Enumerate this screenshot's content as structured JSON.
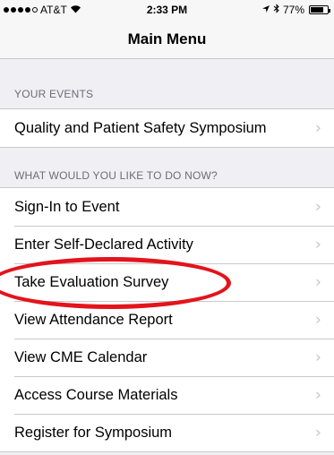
{
  "status_bar": {
    "carrier": "AT&T",
    "time": "2:33 PM",
    "battery": "77%",
    "battery_level": 0.77
  },
  "nav": {
    "title": "Main Menu"
  },
  "events_section": {
    "header": "YOUR EVENTS",
    "items": [
      {
        "label": "Quality and Patient Safety Symposium"
      }
    ]
  },
  "actions_section": {
    "header": "WHAT WOULD YOU LIKE TO DO NOW?",
    "items": [
      {
        "label": "Sign-In to Event"
      },
      {
        "label": "Enter Self-Declared Activity"
      },
      {
        "label": "Take Evaluation Survey"
      },
      {
        "label": "View Attendance Report"
      },
      {
        "label": "View CME Calendar"
      },
      {
        "label": "Access Course Materials"
      },
      {
        "label": "Register for Symposium"
      }
    ]
  },
  "colors": {
    "highlight": "#e3141c",
    "chevron": "#c7c7cc",
    "background": "#efeff4"
  }
}
